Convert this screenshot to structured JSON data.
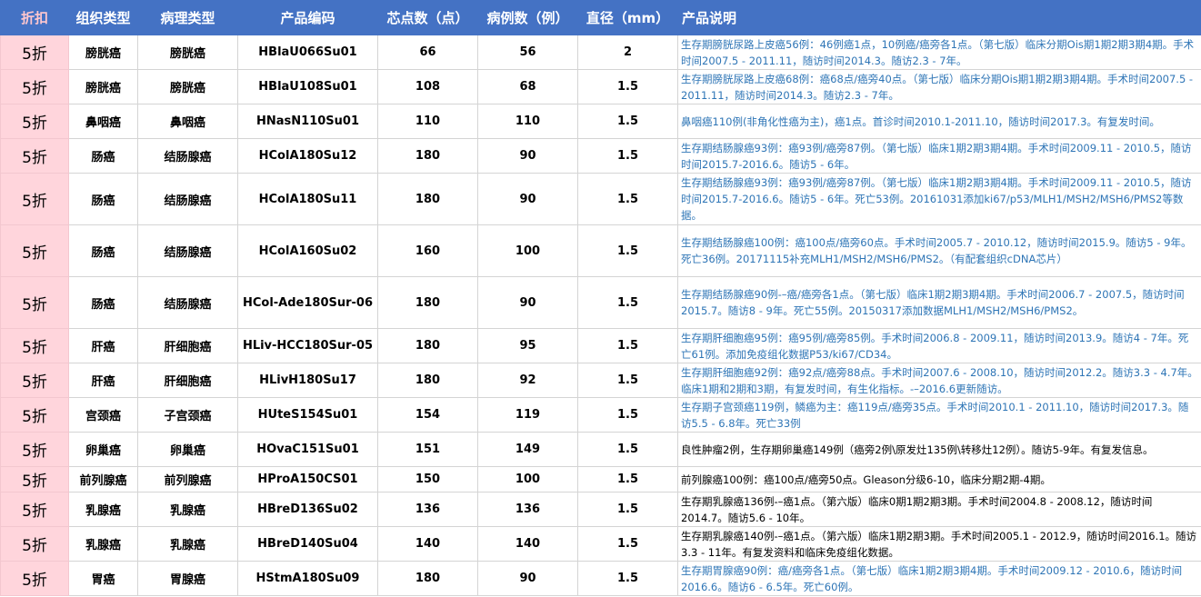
{
  "table": {
    "headers": [
      "折扣",
      "组织类型",
      "病理类型",
      "产品编码",
      "芯点数（点）",
      "病例数（例）",
      "直径（mm）",
      "产品说明"
    ],
    "rows": [
      {
        "discount": "5折",
        "tissue": "膀胱癌",
        "pathology": "膀胱癌",
        "code": "HBlaU066Su01",
        "points": "66",
        "cases": "56",
        "diameter": "2",
        "desc": "生存期膀胱尿路上皮癌56例：46例癌1点，10例癌/癌旁各1点。（第七版）临床分期Ois期1期2期3期4期。手术时间2007.5 - 2011.11，随访时间2014.3。随访2.3 - 7年。",
        "desc_color": "#2e75b6",
        "h": 38
      },
      {
        "discount": "5折",
        "tissue": "膀胱癌",
        "pathology": "膀胱癌",
        "code": "HBlaU108Su01",
        "points": "108",
        "cases": "68",
        "diameter": "1.5",
        "desc": "生存期膀胱尿路上皮癌68例：癌68点/癌旁40点。（第七版）临床分期Ois期1期2期3期4期。手术时间2007.5 - 2011.11，随访时间2014.3。随访2.3 - 7年。",
        "desc_color": "#2e75b6",
        "h": 38
      },
      {
        "discount": "5折",
        "tissue": "鼻咽癌",
        "pathology": "鼻咽癌",
        "code": "HNasN110Su01",
        "points": "110",
        "cases": "110",
        "diameter": "1.5",
        "desc": "鼻咽癌110例(非角化性癌为主)，癌1点。首诊时间2010.1-2011.10，随访时间2017.3。有复发时间。",
        "desc_color": "#2e75b6",
        "h": 38
      },
      {
        "discount": "5折",
        "tissue": "肠癌",
        "pathology": "结肠腺癌",
        "code": "HColA180Su12",
        "points": "180",
        "cases": "90",
        "diameter": "1.5",
        "desc": "生存期结肠腺癌93例：癌93例/癌旁87例。（第七版）临床1期2期3期4期。手术时间2009.11 - 2010.5，随访时间2015.7-2016.6。随访5 - 6年。",
        "desc_color": "#2e75b6",
        "h": 38
      },
      {
        "discount": "5折",
        "tissue": "肠癌",
        "pathology": "结肠腺癌",
        "code": "HColA180Su11",
        "points": "180",
        "cases": "90",
        "diameter": "1.5",
        "desc": "生存期结肠腺癌93例：癌93例/癌旁87例。（第七版）临床1期2期3期4期。手术时间2009.11 - 2010.5，随访时间2015.7-2016.6。随访5 - 6年。死亡53例。20161031添加ki67/p53/MLH1/MSH2/MSH6/PMS2等数据。",
        "desc_color": "#2e75b6",
        "h": 57
      },
      {
        "discount": "5折",
        "tissue": "肠癌",
        "pathology": "结肠腺癌",
        "code": "HColA160Su02",
        "points": "160",
        "cases": "100",
        "diameter": "1.5",
        "desc": "生存期结肠腺癌100例：癌100点/癌旁60点。手术时间2005.7 - 2010.12，随访时间2015.9。随访5 - 9年。死亡36例。20171115补充MLH1/MSH2/MSH6/PMS2。（有配套组织cDNA芯片）",
        "desc_color": "#2e75b6",
        "h": 57
      },
      {
        "discount": "5折",
        "tissue": "肠癌",
        "pathology": "结肠腺癌",
        "code": "HCol-Ade180Sur-06",
        "points": "180",
        "cases": "90",
        "diameter": "1.5",
        "desc": "生存期结肠腺癌90例-–癌/癌旁各1点。（第七版）临床1期2期3期4期。手术时间2006.7 - 2007.5，随访时间2015.7。随访8 - 9年。死亡55例。20150317添加数据MLH1/MSH2/MSH6/PMS2。",
        "desc_color": "#2e75b6",
        "h": 57
      },
      {
        "discount": "5折",
        "tissue": "肝癌",
        "pathology": "肝细胞癌",
        "code": "HLiv-HCC180Sur-05",
        "points": "180",
        "cases": "95",
        "diameter": "1.5",
        "desc": "生存期肝细胞癌95例：癌95例/癌旁85例。手术时间2006.8 - 2009.11，随访时间2013.9。随访4 - 7年。死亡61例。添加免疫组化数据P53/ki67/CD34。",
        "desc_color": "#2e75b6",
        "h": 38
      },
      {
        "discount": "5折",
        "tissue": "肝癌",
        "pathology": "肝细胞癌",
        "code": "HLivH180Su17",
        "points": "180",
        "cases": "92",
        "diameter": "1.5",
        "desc": "生存期肝细胞癌92例：癌92点/癌旁88点。手术时间2007.6 - 2008.10，随访时间2012.2。随访3.3 - 4.7年。临床1期和2期和3期，有复发时间，有生化指标。-–2016.6更新随访。",
        "desc_color": "#2e75b6",
        "h": 38
      },
      {
        "discount": "5折",
        "tissue": "宫颈癌",
        "pathology": "子宫颈癌",
        "code": "HUteS154Su01",
        "points": "154",
        "cases": "119",
        "diameter": "1.5",
        "desc": "生存期子宫颈癌119例，鳞癌为主：癌119点/癌旁35点。手术时间2010.1 - 2011.10，随访时间2017.3。随访5.5 - 6.8年。死亡33例",
        "desc_color": "#2e75b6",
        "h": 38
      },
      {
        "discount": "5折",
        "tissue": "卵巢癌",
        "pathology": "卵巢癌",
        "code": "HOvaC151Su01",
        "points": "151",
        "cases": "149",
        "diameter": "1.5",
        "desc": "良性肿瘤2例，生存期卵巢癌149例（癌旁2例\\原发灶135例\\转移灶12例）。随访5-9年。有复发信息。",
        "desc_color": "#000000",
        "h": 38
      },
      {
        "discount": "5折",
        "tissue": "前列腺癌",
        "pathology": "前列腺癌",
        "code": "HProA150CS01",
        "points": "150",
        "cases": "100",
        "diameter": "1.5",
        "desc": "前列腺癌100例：癌100点/癌旁50点。Gleason分级6-10，临床分期2期-4期。",
        "desc_color": "#000000",
        "h": 28
      },
      {
        "discount": "5折",
        "tissue": "乳腺癌",
        "pathology": "乳腺癌",
        "code": "HBreD136Su02",
        "points": "136",
        "cases": "136",
        "diameter": "1.5",
        "desc": "生存期乳腺癌136例-–癌1点。（第六版）临床0期1期2期3期。手术时间2004.8 - 2008.12，随访时间2014.7。随访5.6 - 10年。",
        "desc_color": "#000000",
        "h": 38
      },
      {
        "discount": "5折",
        "tissue": "乳腺癌",
        "pathology": "乳腺癌",
        "code": "HBreD140Su04",
        "points": "140",
        "cases": "140",
        "diameter": "1.5",
        "desc": "生存期乳腺癌140例-–癌1点。（第六版）临床1期2期3期。手术时间2005.1 - 2012.9，随访时间2016.1。随访3.3 - 11年。有复发资料和临床免疫组化数据。",
        "desc_color": "#000000",
        "h": 38
      },
      {
        "discount": "5折",
        "tissue": "胃癌",
        "pathology": "胃腺癌",
        "code": "HStmA180Su09",
        "points": "180",
        "cases": "90",
        "diameter": "1.5",
        "desc": "生存期胃腺癌90例：癌/癌旁各1点。（第七版）临床1期2期3期4期。手术时间2009.12 - 2010.6，随访时间2016.6。随访6 - 6.5年。死亡60例。",
        "desc_color": "#2e75b6",
        "h": 38
      }
    ]
  }
}
